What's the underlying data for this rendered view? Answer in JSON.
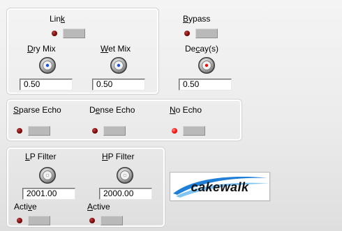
{
  "panels": {
    "mix": {
      "link": {
        "label_pre": "Lin",
        "label_key": "k",
        "label_post": "",
        "active": false
      },
      "dry_mix": {
        "label_pre": "",
        "label_key": "D",
        "label_post": "ry Mix",
        "value": "0.50"
      },
      "wet_mix": {
        "label_pre": "",
        "label_key": "W",
        "label_post": "et Mix",
        "value": "0.50"
      }
    },
    "decay": {
      "bypass": {
        "label_pre": "",
        "label_key": "B",
        "label_post": "ypass",
        "active": false
      },
      "decay": {
        "label_pre": "De",
        "label_key": "c",
        "label_post": "ay(s)",
        "value": "0.50"
      }
    },
    "echo": {
      "sparse": {
        "label_pre": "",
        "label_key": "S",
        "label_post": "parse Echo",
        "active": false
      },
      "dense": {
        "label_pre": "D",
        "label_key": "e",
        "label_post": "nse Echo",
        "active": false
      },
      "none": {
        "label_pre": "",
        "label_key": "N",
        "label_post": "o Echo",
        "active": true
      }
    },
    "filters": {
      "lp": {
        "label_pre": "",
        "label_key": "L",
        "label_post": "P Filter",
        "value": "2001.00",
        "active_pre": "Acti",
        "active_key": "v",
        "active_post": "e",
        "active": false
      },
      "hp": {
        "label_pre": "",
        "label_key": "H",
        "label_post": "P Filter",
        "value": "2000.00",
        "active_pre": "",
        "active_key": "A",
        "active_post": "ctive",
        "active": false
      }
    }
  },
  "logo": {
    "text": "cakewalk"
  },
  "colors": {
    "led_on": "#ff1a1a",
    "led_off": "#7a0a0a",
    "knob_blue": "#1e4fd8",
    "knob_red": "#e01010"
  }
}
